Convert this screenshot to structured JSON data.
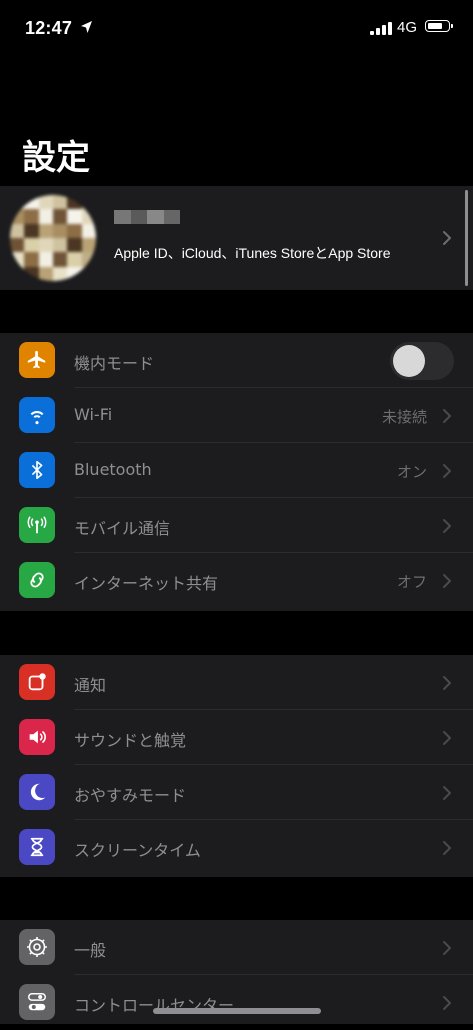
{
  "status_bar": {
    "time": "12:47",
    "network": "4G",
    "battery_level": 0.8
  },
  "title": "設定",
  "profile": {
    "subtitle": "Apple ID、iCloud、iTunes StoreとApp Store"
  },
  "groups": [
    {
      "rows": [
        {
          "label": "機内モード",
          "icon": "airplane-icon",
          "color": "#ff9500",
          "toggle": false
        },
        {
          "label": "Wi-Fi",
          "icon": "wifi-icon",
          "color": "#0a84ff",
          "value": "未接続"
        },
        {
          "label": "Bluetooth",
          "icon": "bluetooth-icon",
          "color": "#0a84ff",
          "value": "オン"
        },
        {
          "label": "モバイル通信",
          "icon": "antenna-icon",
          "color": "#30d158"
        },
        {
          "label": "インターネット共有",
          "icon": "link-icon",
          "color": "#30d158",
          "value": "オフ"
        }
      ]
    },
    {
      "rows": [
        {
          "label": "通知",
          "icon": "notifications-icon",
          "color": "#ff3b30"
        },
        {
          "label": "サウンドと触覚",
          "icon": "speaker-icon",
          "color": "#ff2d55"
        },
        {
          "label": "おやすみモード",
          "icon": "moon-icon",
          "color": "#5e5ce6"
        },
        {
          "label": "スクリーンタイム",
          "icon": "hourglass-icon",
          "color": "#5e5ce6"
        }
      ]
    },
    {
      "rows": [
        {
          "label": "一般",
          "icon": "gear-icon",
          "color": "#8e8e93"
        },
        {
          "label": "コントロールセンター",
          "icon": "toggles-icon",
          "color": "#8e8e93"
        }
      ]
    }
  ]
}
